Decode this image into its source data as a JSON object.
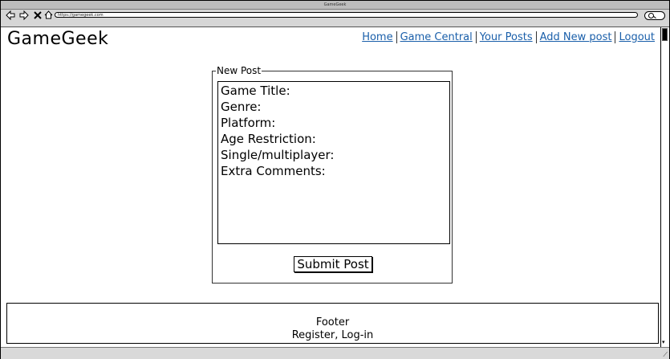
{
  "window": {
    "title": "GameGeek"
  },
  "browser": {
    "url": "https://gamegeek.com",
    "back_icon": "arrow-left-icon",
    "forward_icon": "arrow-right-icon",
    "stop_icon": "close-icon",
    "home_icon": "home-icon"
  },
  "site": {
    "title": "GameGeek"
  },
  "nav": {
    "items": [
      {
        "label": "Home"
      },
      {
        "label": "Game Central"
      },
      {
        "label": "Your Posts"
      },
      {
        "label": "Add New post"
      },
      {
        "label": "Logout"
      }
    ],
    "link_color": "#1a5faa"
  },
  "form": {
    "legend": "New Post",
    "fields": [
      "Game Title:",
      "Genre:",
      "Platform:",
      "Age Restriction:",
      "Single/multiplayer:",
      "Extra Comments:"
    ],
    "submit_label": "Submit Post"
  },
  "footer": {
    "line1": "Footer",
    "line2": "Register, Log-in"
  }
}
